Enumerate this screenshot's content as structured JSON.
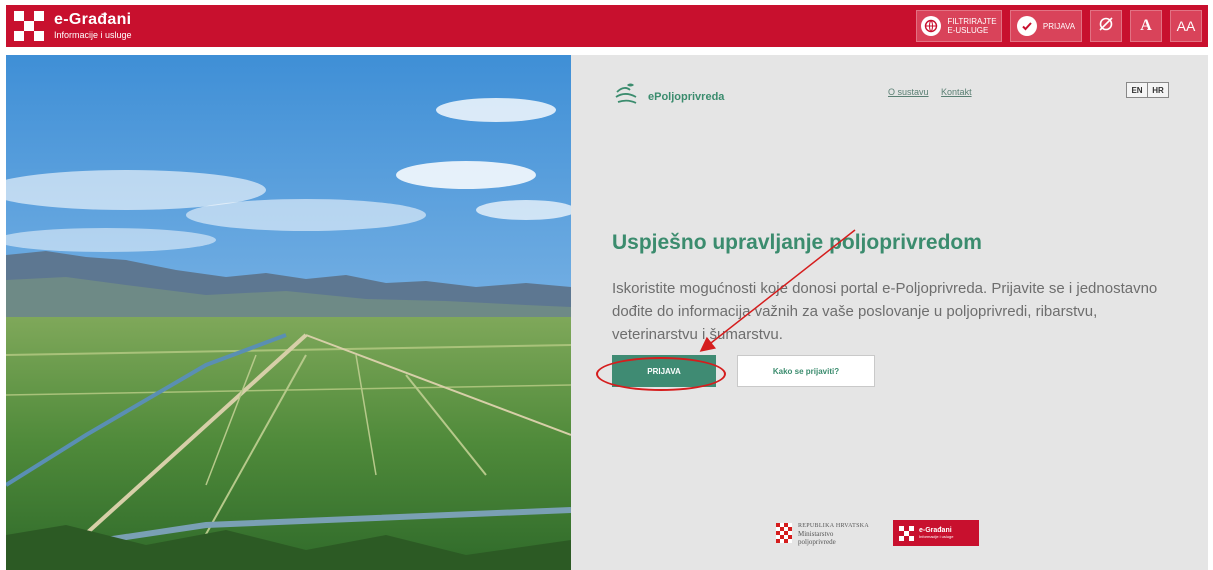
{
  "header": {
    "brand_title": "e-Građani",
    "brand_subtitle": "Informacije i usluge",
    "filter_label_1": "FILTRIRAJTE",
    "filter_label_2": "E-USLUGE",
    "login_label": "PRIJAVA",
    "font_button_label": "A",
    "text_size_label": "AA",
    "colors": {
      "bar": "#c8102e",
      "button": "#d9435a"
    }
  },
  "portal": {
    "name": "ePoljoprivreda",
    "nav": [
      "O sustavu",
      "Kontakt"
    ],
    "languages": [
      "EN",
      "HR"
    ],
    "accent_color": "#3b8c6e"
  },
  "hero_text": {
    "headline": "Uspješno upravljanje poljoprivredom",
    "lead": "Iskoristite mogućnosti koje donosi portal e-Poljoprivreda. Prijavite se i jednostavno dođite do informacija važnih za vaše poslovanje u poljoprivredi, ribarstvu, veterinarstvu i šumarstvu.",
    "login_button": "PRIJAVA",
    "howto_button": "Kako se prijaviti?"
  },
  "footer": {
    "ministry_line1": "REPUBLIKA HRVATSKA",
    "ministry_line2": "Ministarstvo",
    "ministry_line3": "poljoprivrede",
    "egradjani_title": "e-Građani",
    "egradjani_sub": "Informacije i usluge"
  },
  "icons": {
    "filter": "globe-filter-icon",
    "login": "check-circle-icon",
    "visibility": "eye-slash-icon",
    "font": "font-icon",
    "text_size": "text-size-icon",
    "portal": "leaf-field-icon"
  }
}
